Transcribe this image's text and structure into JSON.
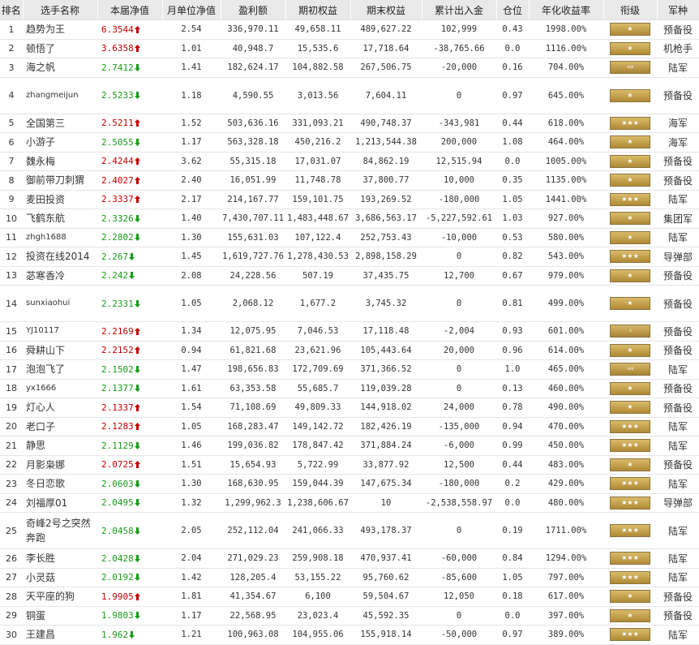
{
  "headers": [
    "排名",
    "选手名称",
    "本届净值",
    "月单位净值",
    "盈利额",
    "期初权益",
    "期末权益",
    "累计出入金",
    "仓位",
    "年化收益率",
    "衔级",
    "军种"
  ],
  "rows": [
    {
      "rank": "1",
      "name": "趋势为王",
      "nav": "6.3544",
      "dir": "up",
      "monthly": "2.54",
      "profit": "336,970.11",
      "start": "49,658.11",
      "end": "489,627.22",
      "flow": "102,999",
      "pos": "0.43",
      "annual": "1998.00%",
      "badge": "star-1",
      "branch": "预备役"
    },
    {
      "rank": "2",
      "name": "顿悟了",
      "nav": "3.6358",
      "dir": "up",
      "monthly": "1.01",
      "profit": "40,948.7",
      "start": "15,535.6",
      "end": "17,718.64",
      "flow": "-38,765.66",
      "pos": "0.0",
      "annual": "1116.00%",
      "badge": "star-1",
      "branch": "机枪手"
    },
    {
      "rank": "3",
      "name": "海之帆",
      "nav": "2.7412",
      "dir": "down",
      "monthly": "1.41",
      "profit": "182,624.17",
      "start": "104,882.58",
      "end": "267,506.75",
      "flow": "-20,000",
      "pos": "0.16",
      "annual": "704.00%",
      "badge": "chev-3",
      "branch": "陆军"
    },
    {
      "rank": "4",
      "name": "zhangmeijun",
      "nav": "2.5233",
      "dir": "down",
      "monthly": "1.18",
      "profit": "4,590.55",
      "start": "3,013.56",
      "end": "7,604.11",
      "flow": "0",
      "pos": "0.97",
      "annual": "645.00%",
      "badge": "star-1",
      "branch": "预备役"
    },
    {
      "rank": "5",
      "name": "全国第三",
      "nav": "2.5211",
      "dir": "up",
      "monthly": "1.52",
      "profit": "503,636.16",
      "start": "331,093.21",
      "end": "490,748.37",
      "flow": "-343,981",
      "pos": "0.44",
      "annual": "618.00%",
      "badge": "star-3",
      "branch": "海军"
    },
    {
      "rank": "6",
      "name": "小游子",
      "nav": "2.5055",
      "dir": "down",
      "monthly": "1.17",
      "profit": "563,328.18",
      "start": "450,216.2",
      "end": "1,213,544.38",
      "flow": "200,000",
      "pos": "1.08",
      "annual": "464.00%",
      "badge": "star-1",
      "branch": "海军"
    },
    {
      "rank": "7",
      "name": "魏永梅",
      "nav": "2.4244",
      "dir": "up",
      "monthly": "3.62",
      "profit": "55,315.18",
      "start": "17,031.07",
      "end": "84,862.19",
      "flow": "12,515.94",
      "pos": "0.0",
      "annual": "1005.00%",
      "badge": "star-1",
      "branch": "预备役"
    },
    {
      "rank": "8",
      "name": "御前带刀刺猬",
      "nav": "2.4027",
      "dir": "up",
      "monthly": "2.40",
      "profit": "16,051.99",
      "start": "11,748.78",
      "end": "37,800.77",
      "flow": "10,000",
      "pos": "0.35",
      "annual": "1135.00%",
      "badge": "star-1",
      "branch": "预备役"
    },
    {
      "rank": "9",
      "name": "麦田投资",
      "nav": "2.3337",
      "dir": "up",
      "monthly": "2.17",
      "profit": "214,167.77",
      "start": "159,101.75",
      "end": "193,269.52",
      "flow": "-180,000",
      "pos": "1.05",
      "annual": "1441.00%",
      "badge": "star-3",
      "branch": "陆军"
    },
    {
      "rank": "10",
      "name": "飞鹤东航",
      "nav": "2.3326",
      "dir": "down",
      "monthly": "1.40",
      "profit": "7,430,707.11",
      "start": "1,483,448.67",
      "end": "3,686,563.17",
      "flow": "-5,227,592.61",
      "pos": "1.03",
      "annual": "927.00%",
      "badge": "star-1",
      "branch": "集团军"
    },
    {
      "rank": "11",
      "name": "zhgh1688",
      "nav": "2.2802",
      "dir": "down",
      "monthly": "1.30",
      "profit": "155,631.03",
      "start": "107,122.4",
      "end": "252,753.43",
      "flow": "-10,000",
      "pos": "0.53",
      "annual": "580.00%",
      "badge": "star-1",
      "branch": "陆军"
    },
    {
      "rank": "12",
      "name": "投资在线2014",
      "nav": "2.267",
      "dir": "down",
      "monthly": "1.45",
      "profit": "1,619,727.76",
      "start": "1,278,430.53",
      "end": "2,898,158.29",
      "flow": "0",
      "pos": "0.82",
      "annual": "543.00%",
      "badge": "star-3",
      "branch": "导弹部"
    },
    {
      "rank": "13",
      "name": "苾寒香冷",
      "nav": "2.242",
      "dir": "down",
      "monthly": "2.08",
      "profit": "24,228.56",
      "start": "507.19",
      "end": "37,435.75",
      "flow": "12,700",
      "pos": "0.67",
      "annual": "979.00%",
      "badge": "star-1",
      "branch": "预备役"
    },
    {
      "rank": "14",
      "name": "sunxiaohui",
      "nav": "2.2331",
      "dir": "down",
      "monthly": "1.05",
      "profit": "2,068.12",
      "start": "1,677.2",
      "end": "3,745.32",
      "flow": "0",
      "pos": "0.81",
      "annual": "499.00%",
      "badge": "star-1",
      "branch": "预备役"
    },
    {
      "rank": "15",
      "name": "YJ10117",
      "nav": "2.2169",
      "dir": "up",
      "monthly": "1.34",
      "profit": "12,075.95",
      "start": "7,046.53",
      "end": "17,118.48",
      "flow": "-2,004",
      "pos": "0.93",
      "annual": "601.00%",
      "badge": "chev-1",
      "branch": "预备役"
    },
    {
      "rank": "16",
      "name": "舜耕山下",
      "nav": "2.2152",
      "dir": "up",
      "monthly": "0.94",
      "profit": "61,821.68",
      "start": "23,621.96",
      "end": "105,443.64",
      "flow": "20,000",
      "pos": "0.96",
      "annual": "614.00%",
      "badge": "star-1",
      "branch": "预备役"
    },
    {
      "rank": "17",
      "name": "泡泡飞了",
      "nav": "2.1502",
      "dir": "down",
      "monthly": "1.47",
      "profit": "198,656.83",
      "start": "172,709.69",
      "end": "371,366.52",
      "flow": "0",
      "pos": "1.0",
      "annual": "465.00%",
      "badge": "chev-3",
      "branch": "陆军"
    },
    {
      "rank": "18",
      "name": "yx1666",
      "nav": "2.1377",
      "dir": "down",
      "monthly": "1.61",
      "profit": "63,353.58",
      "start": "55,685.7",
      "end": "119,039.28",
      "flow": "0",
      "pos": "0.13",
      "annual": "460.00%",
      "badge": "star-1",
      "branch": "预备役"
    },
    {
      "rank": "19",
      "name": "灯心人",
      "nav": "2.1337",
      "dir": "up",
      "monthly": "1.54",
      "profit": "71,108.69",
      "start": "49,809.33",
      "end": "144,918.02",
      "flow": "24,000",
      "pos": "0.78",
      "annual": "490.00%",
      "badge": "star-1",
      "branch": "预备役"
    },
    {
      "rank": "20",
      "name": "老口子",
      "nav": "2.1283",
      "dir": "up",
      "monthly": "1.05",
      "profit": "168,283.47",
      "start": "149,142.72",
      "end": "182,426.19",
      "flow": "-135,000",
      "pos": "0.94",
      "annual": "470.00%",
      "badge": "star-3",
      "branch": "陆军"
    },
    {
      "rank": "21",
      "name": "静思",
      "nav": "2.1129",
      "dir": "down",
      "monthly": "1.46",
      "profit": "199,036.82",
      "start": "178,847.42",
      "end": "371,884.24",
      "flow": "-6,000",
      "pos": "0.99",
      "annual": "450.00%",
      "badge": "star-3",
      "branch": "陆军"
    },
    {
      "rank": "22",
      "name": "月影枭娜",
      "nav": "2.0725",
      "dir": "up",
      "monthly": "1.51",
      "profit": "15,654.93",
      "start": "5,722.99",
      "end": "33,877.92",
      "flow": "12,500",
      "pos": "0.44",
      "annual": "483.00%",
      "badge": "star-1",
      "branch": "预备役"
    },
    {
      "rank": "23",
      "name": "冬日恋歌",
      "nav": "2.0603",
      "dir": "down",
      "monthly": "1.30",
      "profit": "168,630.95",
      "start": "159,044.39",
      "end": "147,675.34",
      "flow": "-180,000",
      "pos": "0.2",
      "annual": "429.00%",
      "badge": "star-3",
      "branch": "陆军"
    },
    {
      "rank": "24",
      "name": "刘福厚01",
      "nav": "2.0495",
      "dir": "down",
      "monthly": "1.32",
      "profit": "1,299,962.3",
      "start": "1,238,606.67",
      "end": "10",
      "flow": "-2,538,558.97",
      "pos": "0.0",
      "annual": "480.00%",
      "badge": "star-3",
      "branch": "导弹部"
    },
    {
      "rank": "25",
      "name": "奇峰2号之突然奔跑",
      "nav": "2.0458",
      "dir": "down",
      "monthly": "2.05",
      "profit": "252,112.04",
      "start": "241,066.33",
      "end": "493,178.37",
      "flow": "0",
      "pos": "0.19",
      "annual": "1711.00%",
      "badge": "star-3",
      "branch": "陆军"
    },
    {
      "rank": "26",
      "name": "李长胜",
      "nav": "2.0428",
      "dir": "down",
      "monthly": "2.04",
      "profit": "271,029.23",
      "start": "259,908.18",
      "end": "470,937.41",
      "flow": "-60,000",
      "pos": "0.84",
      "annual": "1294.00%",
      "badge": "star-3",
      "branch": "陆军"
    },
    {
      "rank": "27",
      "name": "小灵菇",
      "nav": "2.0192",
      "dir": "down",
      "monthly": "1.42",
      "profit": "128,205.4",
      "start": "53,155.22",
      "end": "95,760.62",
      "flow": "-85,600",
      "pos": "1.05",
      "annual": "797.00%",
      "badge": "star-3",
      "branch": "陆军"
    },
    {
      "rank": "28",
      "name": "天平座的狗",
      "nav": "1.9905",
      "dir": "up",
      "monthly": "1.81",
      "profit": "41,354.67",
      "start": "6,100",
      "end": "59,504.67",
      "flow": "12,050",
      "pos": "0.18",
      "annual": "617.00%",
      "badge": "star-1",
      "branch": "预备役"
    },
    {
      "rank": "29",
      "name": "铜蛋",
      "nav": "1.9803",
      "dir": "down",
      "monthly": "1.17",
      "profit": "22,568.95",
      "start": "23,023.4",
      "end": "45,592.35",
      "flow": "0",
      "pos": "0.0",
      "annual": "397.00%",
      "badge": "star-1",
      "branch": "预备役"
    },
    {
      "rank": "30",
      "name": "王建昌",
      "nav": "1.962",
      "dir": "down",
      "monthly": "1.21",
      "profit": "100,963.08",
      "start": "104,955.06",
      "end": "155,918.14",
      "flow": "-50,000",
      "pos": "0.97",
      "annual": "389.00%",
      "badge": "star-3",
      "branch": "陆军"
    }
  ],
  "colors": {
    "up": "#c00000",
    "down": "#1a9a1a",
    "header_bg": "#e9e9e9",
    "badge_gold": "#c8a24e"
  },
  "icons": {
    "up": "up-arrow-icon",
    "down": "down-arrow-icon",
    "badge": "rank-insignia-icon"
  }
}
